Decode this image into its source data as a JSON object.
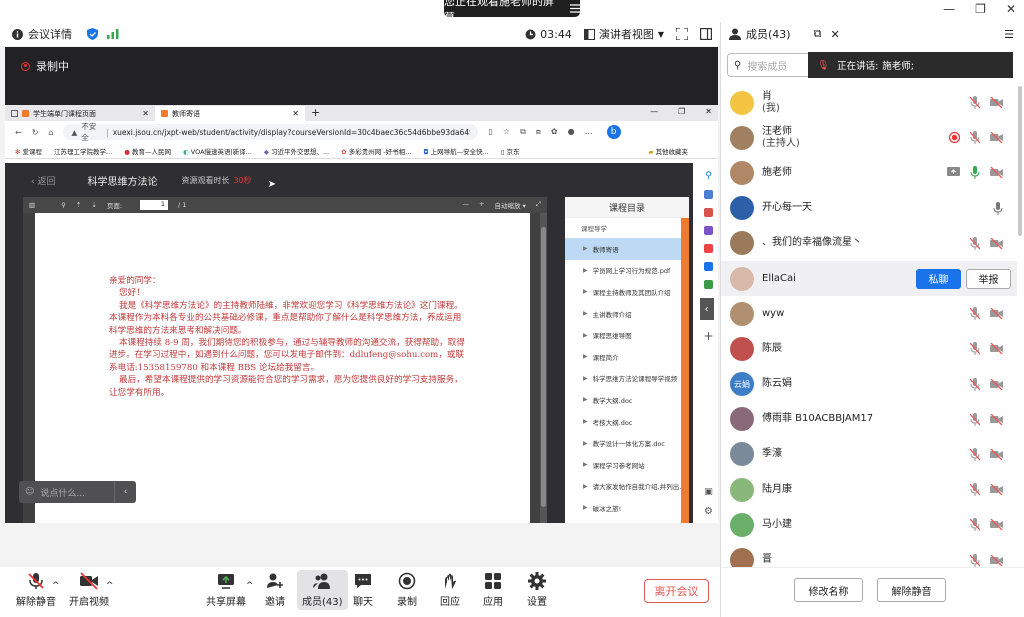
{
  "share": {
    "text": "您正在观看施老师的屏幕",
    "icon": "menu-icon"
  },
  "window_controls": [
    "minimize-icon",
    "restore-icon",
    "close-icon"
  ],
  "meeting_bar": {
    "details": "会议详情",
    "time": "03:44",
    "view": "演讲者视图"
  },
  "recording": "录制中",
  "browser": {
    "tabs": [
      {
        "label": "学生端单门课程页面",
        "active": false
      },
      {
        "label": "教师寄语",
        "active": true
      }
    ],
    "insecure": "不安全",
    "url": "xuexi.jsou.cn/jxpt-web/student/activity/display?courseVersionId=30c4baec36c54d6bbe93da64952f3...",
    "bookmarks": [
      "爱课程",
      "江苏理工学院教学...",
      "教育—人民网",
      "VOA慢速英语|新译...",
      "习近平外交思想、...",
      "多彩贵州网 -好书相...",
      "上网导航—安全快...",
      "京东"
    ],
    "other_bookmarks": "其他收藏夹"
  },
  "course": {
    "back": "返回",
    "title": "科学思维方法论",
    "timer_label": "资源观看时长",
    "timer_value": "30秒",
    "pdf": {
      "page_label": "页面:",
      "page": "1",
      "total": "/ 1",
      "zoom": "自动缩放"
    },
    "letter": [
      "亲爱的同学：",
      "您好！",
      "我是《科学思维方法论》的主持教师陆維，非常欢迎您学习《科学思维方法论》这门课程。本课程作为本科各专业的公共基础必修课，重点是帮助你了解什么是科学思维方法，养成运用科学思维的方法来思考和解决问题。",
      "本课程持续 8-9 周，我们期待您的积极参与，通过与辅导教师的沟通交流，获得帮助，取得进步。在学习过程中，如遇到什么问题，您可以发电子邮件到：ddlufeng@sohu.com，或联系电话:15358159780 和本课程 BBS 论坛给我留言。",
      "最后，希望本课程提供的学习资源能符合您的学习需求，愿为您提供良好的学习支持服务，让您学有所用。"
    ],
    "chat_placeholder": "说点什么...",
    "catalog": {
      "title": "课程目录",
      "section": "课程导学",
      "items": [
        {
          "label": "教师寄语",
          "active": true
        },
        {
          "label": "学员网上学习行为规范.pdf",
          "active": false
        },
        {
          "label": "课程主持教师及其团队介绍",
          "active": false
        },
        {
          "label": "主讲教师介绍",
          "active": false
        },
        {
          "label": "课程思维导图",
          "active": false
        },
        {
          "label": "课程简介",
          "active": false
        },
        {
          "label": "科学思维方法论课程导学视频",
          "active": false
        },
        {
          "label": "教学大纲.doc",
          "active": false
        },
        {
          "label": "考核大纲.doc",
          "active": false
        },
        {
          "label": "教学设计一体化方案.doc",
          "active": false
        },
        {
          "label": "课程学习参考网站",
          "active": false
        },
        {
          "label": "请大家发帖作自我介绍,并列出...",
          "active": false
        },
        {
          "label": "破冰之旅!",
          "active": false
        }
      ]
    }
  },
  "toolbar": {
    "unmute": "解除静音",
    "video": "开启视频",
    "share": "共享屏幕",
    "invite": "邀请",
    "members": "成员(43)",
    "chat": "聊天",
    "record": "录制",
    "playback": "回应",
    "apps": "应用",
    "settings": "设置",
    "leave": "离开会议"
  },
  "panel": {
    "title": "成员(43)",
    "search_placeholder": "搜索成员",
    "speaking_label": "正在讲话:",
    "speaking_name": "施老师;",
    "members": [
      {
        "name": "肖",
        "role": "(我)",
        "color": "#f4c542",
        "mic": "muted",
        "cam": "off"
      },
      {
        "name": "汪老师",
        "role": "(主持人)",
        "color": "#a08060",
        "mic": "muted",
        "cam": "off",
        "rec": true
      },
      {
        "name": "施老师",
        "role": "",
        "color": "#b08868",
        "mic": "on",
        "cam": "off",
        "share": true
      },
      {
        "name": "开心每一天",
        "role": "",
        "color": "#2d5fa8",
        "mic": "plain",
        "cam": "none"
      },
      {
        "name": "、我们的幸福像流星丶",
        "role": "",
        "color": "#9a7a5a",
        "mic": "muted",
        "cam": "off"
      },
      {
        "name": "EllaCai",
        "role": "",
        "color": "#d8b8a8",
        "mic": "none",
        "cam": "none",
        "hover": true
      },
      {
        "name": "wyw",
        "role": "",
        "color": "#b09070",
        "mic": "muted",
        "cam": "off"
      },
      {
        "name": "陈辰",
        "role": "",
        "color": "#c0504d",
        "mic": "muted",
        "cam": "off"
      },
      {
        "name": "陈云娟",
        "role": "",
        "color": "#3d7ec6",
        "mic": "muted",
        "cam": "off",
        "initials": "云娟"
      },
      {
        "name": "傅雨菲 B10ACBBJAM17",
        "role": "",
        "color": "#8a6a7a",
        "mic": "muted",
        "cam": "off"
      },
      {
        "name": "季濠",
        "role": "",
        "color": "#7a8a9a",
        "mic": "muted",
        "cam": "off"
      },
      {
        "name": "陆月康",
        "role": "",
        "color": "#8ab87a",
        "mic": "muted",
        "cam": "off"
      },
      {
        "name": "马小建",
        "role": "",
        "color": "#6ab06a",
        "mic": "muted",
        "cam": "off"
      },
      {
        "name": "晋",
        "role": "",
        "color": "#a07050",
        "mic": "muted",
        "cam": "off"
      }
    ],
    "private_chat": "私聊",
    "report": "举报",
    "rename": "修改名称",
    "unmute_all": "解除静音"
  },
  "colors": {
    "accent": "#1a73e8",
    "leave": "#e15a55",
    "letter": "#c13a3a",
    "catalog_bar": "#f07a2d"
  }
}
